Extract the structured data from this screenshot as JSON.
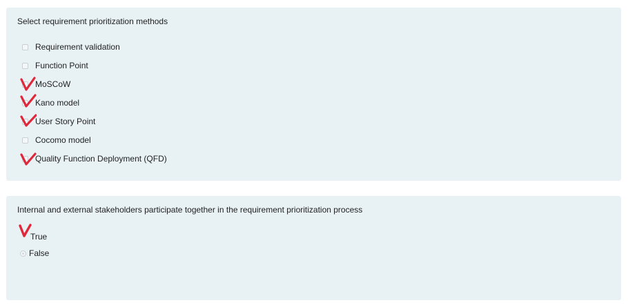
{
  "colors": {
    "panel_bg": "#e8f1f4",
    "check_mark": "#e0283c"
  },
  "question1": {
    "title": "Select requirement prioritization methods",
    "options": [
      {
        "label": "Requirement validation",
        "checked": false
      },
      {
        "label": "Function Point",
        "checked": false
      },
      {
        "label": "MoSCoW",
        "checked": true
      },
      {
        "label": "Kano model",
        "checked": true
      },
      {
        "label": "User Story Point",
        "checked": true
      },
      {
        "label": "Cocomo model",
        "checked": false
      },
      {
        "label": "Quality Function Deployment (QFD)",
        "checked": true
      }
    ]
  },
  "question2": {
    "title": "Internal and external stakeholders participate together in the requirement prioritization process",
    "options": [
      {
        "label": "True",
        "selected": true
      },
      {
        "label": "False",
        "selected": false
      }
    ]
  }
}
